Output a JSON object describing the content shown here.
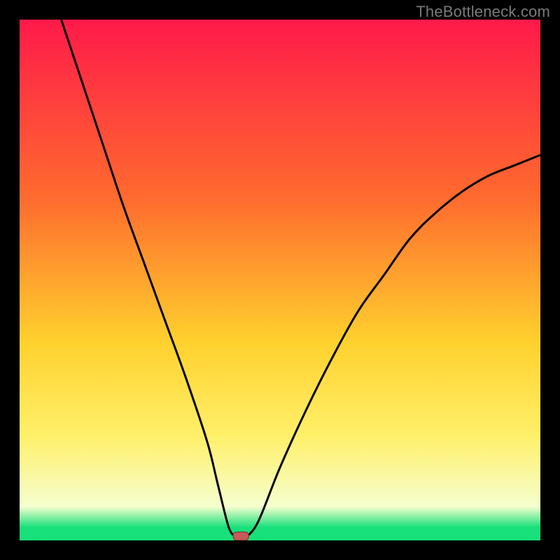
{
  "watermark": "TheBottleneck.com",
  "colors": {
    "bg": "#000000",
    "grad_top": "#ff1a4a",
    "grad_mid1": "#ff6a2e",
    "grad_mid2": "#ffd12e",
    "grad_lower": "#fff06a",
    "grad_pale": "#f6ffcf",
    "grad_bottom": "#18e07a",
    "curve": "#000000",
    "marker_fill": "#c85a5a",
    "marker_stroke": "#7a2d2d"
  },
  "chart_data": {
    "type": "line",
    "title": "",
    "xlabel": "",
    "ylabel": "",
    "xlim": [
      0,
      100
    ],
    "ylim": [
      0,
      100
    ],
    "series": [
      {
        "name": "bottleneck-curve-left",
        "x": [
          8,
          12,
          16,
          20,
          24,
          28,
          32,
          36,
          38,
          40,
          41
        ],
        "values": [
          100,
          88,
          76,
          64,
          53,
          42,
          31,
          19,
          11,
          3,
          1
        ]
      },
      {
        "name": "bottleneck-curve-right",
        "x": [
          44,
          46,
          50,
          55,
          60,
          65,
          70,
          75,
          80,
          85,
          90,
          95,
          100
        ],
        "values": [
          1,
          4,
          14,
          25,
          35,
          44,
          51,
          58,
          63,
          67,
          70,
          72,
          74
        ]
      }
    ],
    "marker": {
      "x": 42.5,
      "y": 0.8
    },
    "gradient_stops": [
      {
        "offset": 0.0,
        "key": "grad_top"
      },
      {
        "offset": 0.34,
        "key": "grad_mid1"
      },
      {
        "offset": 0.62,
        "key": "grad_mid2"
      },
      {
        "offset": 0.8,
        "key": "grad_lower"
      },
      {
        "offset": 0.935,
        "key": "grad_pale"
      },
      {
        "offset": 0.975,
        "key": "grad_bottom"
      },
      {
        "offset": 1.0,
        "key": "grad_bottom"
      }
    ]
  }
}
